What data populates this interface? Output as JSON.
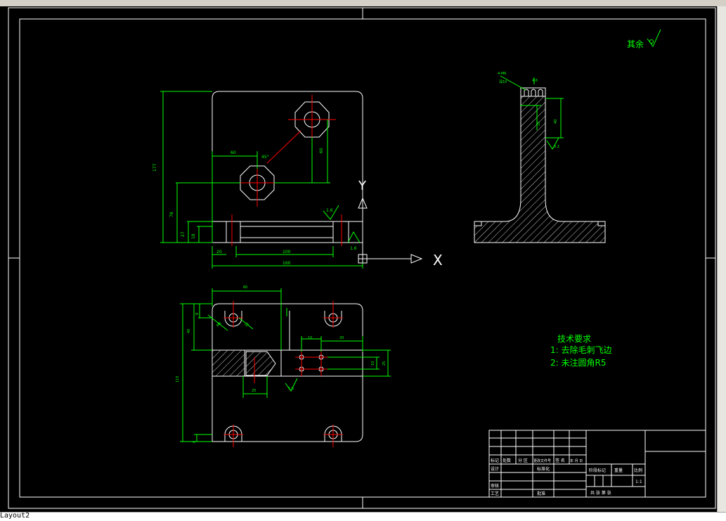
{
  "window": {
    "layout_tab": "Layout2"
  },
  "colors": {
    "background": "#000000",
    "outline": "#ffffff",
    "dimension": "#00ff00",
    "center": "#ff0000",
    "hatch": "#ffffff"
  },
  "roughness": {
    "label": "其余",
    "symbol": "∇"
  },
  "notes": {
    "title": "技术要求",
    "items": [
      "1: 去除毛刺飞边",
      "2: 未注圆角R5"
    ]
  },
  "ucs": {
    "x_label": "X",
    "y_label": "Y"
  },
  "title_block": {
    "row1": [
      "标记",
      "处数",
      "分 区",
      "更改文件号",
      "签 名",
      "年 月 日"
    ],
    "design": "设计",
    "standardize": "标准化",
    "review": "审核",
    "process": "工艺",
    "approve": "批准",
    "stage_label": "阶段标记",
    "weight": "重量",
    "scale": "比例",
    "scale_value": "1:1",
    "sheets": "共  张  第  张"
  }
}
